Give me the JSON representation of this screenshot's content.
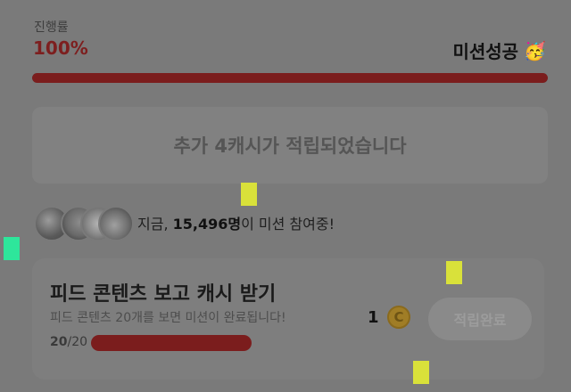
{
  "progress": {
    "label": "진행률",
    "value_text": "100%",
    "value": 100,
    "status": "미션성공",
    "status_icon": "party-face-icon",
    "fill_color": "#7b1d1d"
  },
  "reward_banner": {
    "text": "추가 4캐시가 적립되었습니다"
  },
  "participants": {
    "prefix": "지금, ",
    "count": "15,496명",
    "suffix": "이 미션 참여중!"
  },
  "mission": {
    "title": "피드 콘텐츠 보고 캐시 받기",
    "description": "피드 콘텐츠 20개를 보면 미션이 완료됩니다!",
    "done": "20",
    "total_text": "/20",
    "progress": 1.0,
    "reward_count": "1",
    "reward_icon": "cash-coin-icon",
    "button_label": "적립완료"
  },
  "colors": {
    "accent": "#7b1d1d",
    "marker_yellow": "#d9e13a",
    "marker_green": "#2ee69b"
  }
}
